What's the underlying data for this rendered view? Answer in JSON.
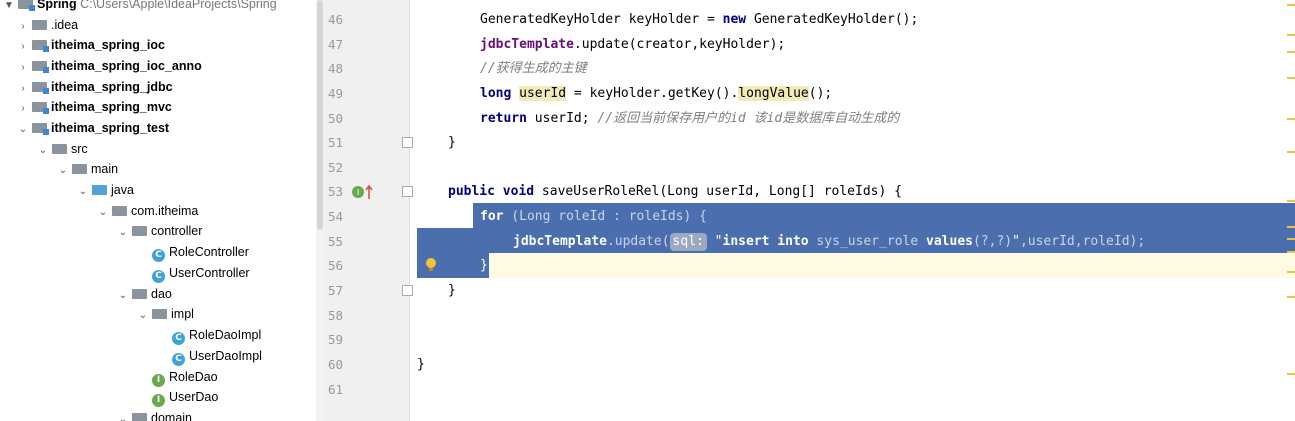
{
  "tree": {
    "root": {
      "name": "Spring",
      "path": "C:\\Users\\Apple\\IdeaProjects\\Spring"
    },
    "items": [
      {
        "label": ".idea"
      },
      {
        "label": "itheima_spring_ioc"
      },
      {
        "label": "itheima_spring_ioc_anno"
      },
      {
        "label": "itheima_spring_jdbc"
      },
      {
        "label": "itheima_spring_mvc"
      },
      {
        "label": "itheima_spring_test"
      },
      {
        "label": "src"
      },
      {
        "label": "main"
      },
      {
        "label": "java"
      },
      {
        "label": "com.itheima"
      },
      {
        "label": "controller"
      },
      {
        "label": "RoleController"
      },
      {
        "label": "UserController"
      },
      {
        "label": "dao"
      },
      {
        "label": "impl"
      },
      {
        "label": "RoleDaoImpl"
      },
      {
        "label": "UserDaoImpl"
      },
      {
        "label": "RoleDao"
      },
      {
        "label": "UserDao"
      },
      {
        "label": "domain"
      }
    ]
  },
  "editor": {
    "line_numbers": [
      "46",
      "47",
      "48",
      "49",
      "50",
      "51",
      "52",
      "53",
      "54",
      "55",
      "56",
      "57",
      "58",
      "59",
      "60",
      "61"
    ],
    "code": {
      "l46_type": "GeneratedKeyHolder keyHolder = ",
      "l46_new": "new",
      "l46_rest": " GeneratedKeyHolder();",
      "l47_field": "jdbcTemplate",
      "l47_rest": ".update(creator,keyHolder);",
      "l48_comment": "//获得生成的主键",
      "l49_long": "long",
      "l49_var": "userId",
      "l49_mid": " = keyHolder.getKey().",
      "l49_method": "longValue",
      "l49_end": "();",
      "l50_return": "return",
      "l50_rest": " userId; ",
      "l50_comment": "//返回当前保存用户的id 该id是数据库自动生成的",
      "l51": "}",
      "l53_public": "public",
      "l53_void": "void",
      "l53_rest": " saveUserRoleRel(Long userId, Long[] roleIds) {",
      "l54_for": "for",
      "l54_rest": " (Long roleId : roleIds) {",
      "l55_field": "jdbcTemplate",
      "l55_update": ".update(",
      "l55_hint": "sql:",
      "l55_q1": " \"",
      "l55_insert": "insert into",
      "l55_table": " sys_user_role ",
      "l55_values": "values",
      "l55_args": "(?,?)",
      "l55_q2": "\"",
      "l55_end": ",userId,roleId);",
      "l56": "}",
      "l57": "}",
      "l60": "}"
    }
  },
  "colors": {
    "selection": "#4b6eaf",
    "keyword": "#000080",
    "field": "#660e7a",
    "comment": "#808080"
  }
}
